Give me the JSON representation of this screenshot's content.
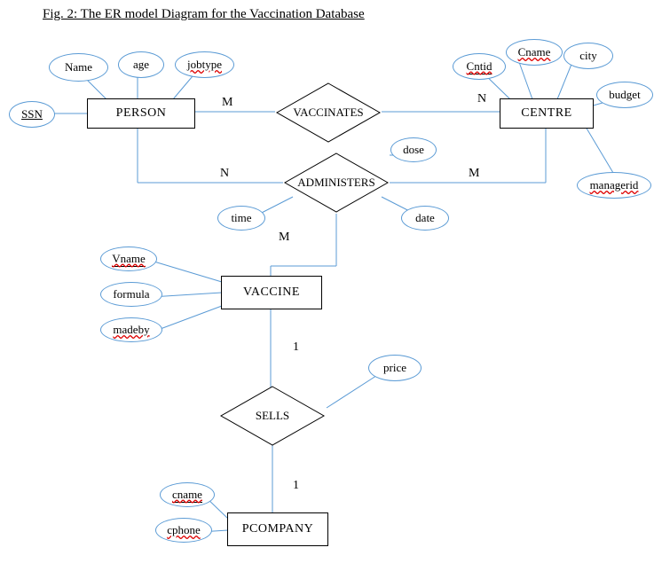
{
  "title": "Fig. 2: The ER model Diagram for the Vaccination Database",
  "entities": {
    "person": "PERSON",
    "centre": "CENTRE",
    "vaccine": "VACCINE",
    "pcompany": "PCOMPANY"
  },
  "relationships": {
    "vaccinates": "VACCINATES",
    "administers": "ADMINISTERS",
    "sells": "SELLS"
  },
  "attributes": {
    "ssn": "SSN",
    "name": "Name",
    "age": "age",
    "jobtype": "jobtype",
    "cntid": "Cntid",
    "cname_centre": "Cname",
    "city": "city",
    "budget": "budget",
    "managerid": "managerid",
    "dose": "dose",
    "time": "time",
    "date": "date",
    "vname": "Vname",
    "formula": "formula",
    "madeby": "madeby",
    "price": "price",
    "cname": "cname",
    "cphone": "cphone"
  },
  "cardinality": {
    "M1": "M",
    "N1": "N",
    "N2": "N",
    "M2": "M",
    "M3": "M",
    "one1": "1",
    "one2": "1"
  },
  "chart_data": {
    "type": "er-diagram",
    "entities": [
      {
        "name": "PERSON",
        "attributes": [
          "SSN",
          "Name",
          "age",
          "jobtype"
        ],
        "keys": [
          "SSN"
        ]
      },
      {
        "name": "CENTRE",
        "attributes": [
          "Cntid",
          "Cname",
          "city",
          "budget",
          "managerid"
        ],
        "keys": [
          "Cntid"
        ]
      },
      {
        "name": "VACCINE",
        "attributes": [
          "Vname",
          "formula",
          "madeby"
        ],
        "keys": [
          "Vname"
        ]
      },
      {
        "name": "PCOMPANY",
        "attributes": [
          "cname",
          "cphone"
        ],
        "keys": [
          "cname"
        ]
      }
    ],
    "relationships": [
      {
        "name": "VACCINATES",
        "between": [
          "PERSON",
          "CENTRE"
        ],
        "cardinality": [
          "M",
          "N"
        ],
        "attributes": []
      },
      {
        "name": "ADMINISTERS",
        "between": [
          "PERSON",
          "CENTRE",
          "VACCINE"
        ],
        "cardinality": [
          "N",
          "M",
          "M"
        ],
        "attributes": [
          "dose",
          "time",
          "date"
        ]
      },
      {
        "name": "SELLS",
        "between": [
          "VACCINE",
          "PCOMPANY"
        ],
        "cardinality": [
          "1",
          "1"
        ],
        "attributes": [
          "price"
        ]
      }
    ]
  }
}
